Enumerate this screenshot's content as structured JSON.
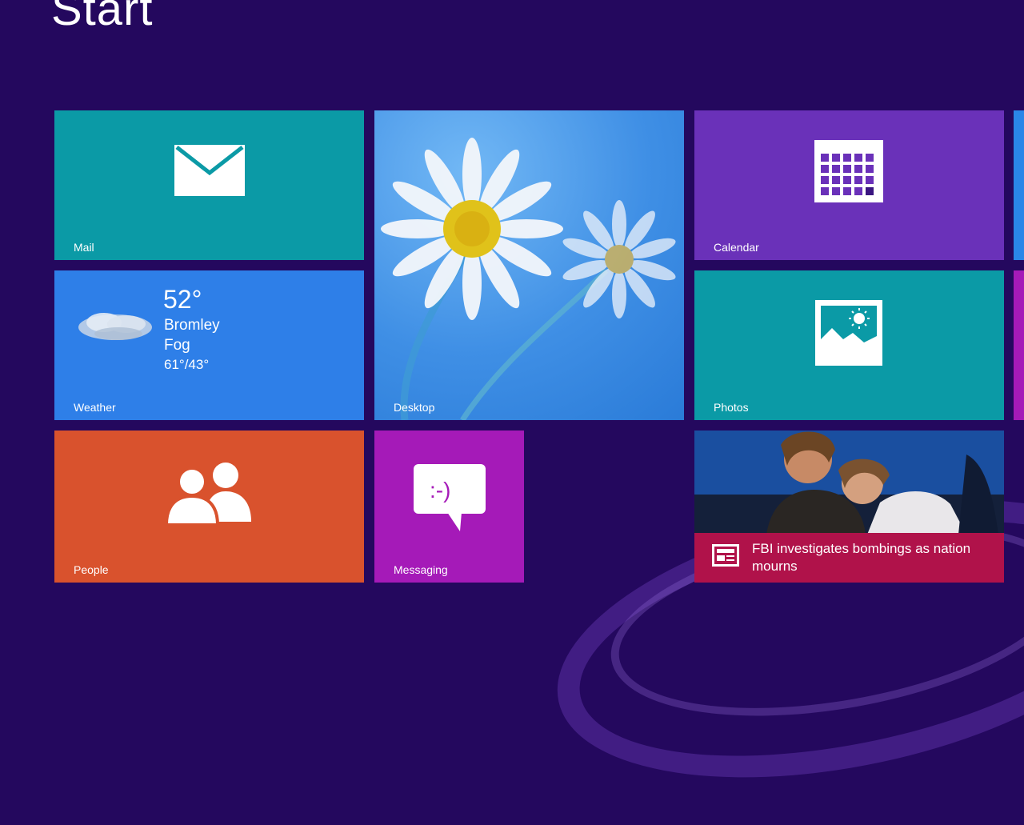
{
  "start_screen": {
    "title": "Start"
  },
  "tiles": {
    "mail": {
      "label": "Mail",
      "icon": "mail-icon"
    },
    "desktop": {
      "label": "Desktop",
      "background": "daisies-wallpaper"
    },
    "calendar": {
      "label": "Calendar",
      "icon": "calendar-icon"
    },
    "weather": {
      "label": "Weather",
      "temperature": "52°",
      "location": "Bromley",
      "condition": "Fog",
      "range": "61°/43°",
      "icon": "cloud-icon"
    },
    "photos": {
      "label": "Photos",
      "icon": "photos-icon"
    },
    "people": {
      "label": "People",
      "icon": "people-icon"
    },
    "messaging": {
      "label": "Messaging",
      "icon": "messaging-icon"
    },
    "news": {
      "headline": "FBI investigates bombings as nation mourns",
      "icon": "news-icon"
    }
  },
  "colors": {
    "background": "#24085e",
    "mail": "#0b9aa6",
    "desktop": "#3f8fe5",
    "calendar": "#6a31b9",
    "weather": "#2e7fe8",
    "photos": "#0b9aa6",
    "people": "#d9522d",
    "messaging": "#a51ab8",
    "news_bar": "#b0124a"
  }
}
